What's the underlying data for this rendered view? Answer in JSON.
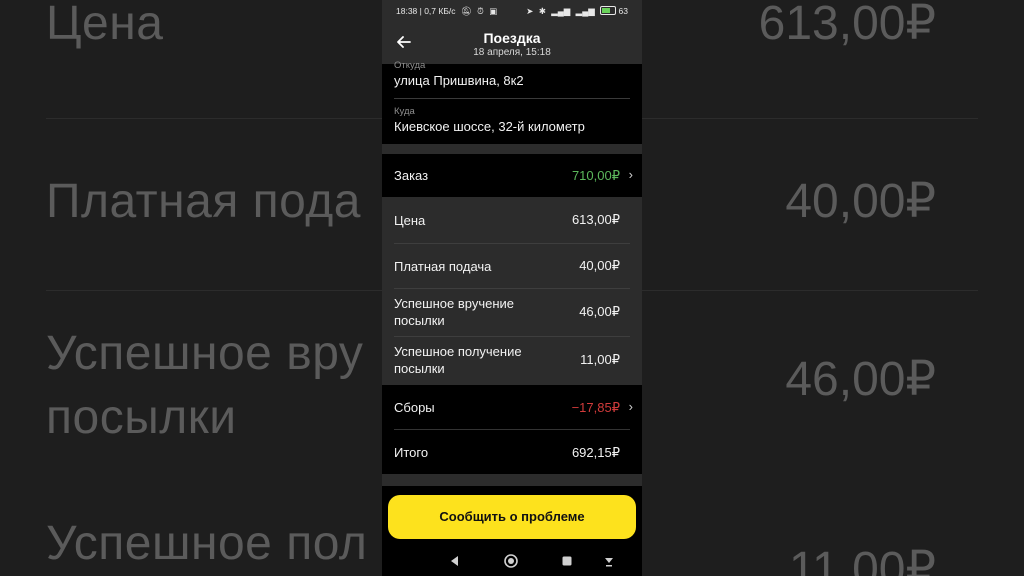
{
  "background": {
    "rows": [
      {
        "label": "Цена",
        "value": "613,00₽"
      },
      {
        "label": "Платная пода",
        "value": "40,00₽"
      },
      {
        "label": "Успешное вру",
        "label2": "посылки",
        "value": "46,00₽"
      },
      {
        "label": "Успешное пол",
        "value": "11,00₽"
      }
    ]
  },
  "statusbar": {
    "left": "18:38 | 0,7 КБ/с",
    "battery": "63"
  },
  "header": {
    "title": "Поездка",
    "subtitle": "18 апреля, 15:18"
  },
  "route": {
    "from_label": "Откуда",
    "from_value": "улица Пришвина, 8к2",
    "to_label": "Куда",
    "to_value": "Киевское шоссе, 32-й километр"
  },
  "order": {
    "label": "Заказ",
    "value": "710,00₽"
  },
  "breakdown": [
    {
      "label": "Цена",
      "value": "613,00₽"
    },
    {
      "label": "Платная подача",
      "value": "40,00₽"
    },
    {
      "label": "Успешное вручение посылки",
      "value": "46,00₽"
    },
    {
      "label": "Успешное получение посылки",
      "value": "11,00₽"
    }
  ],
  "fees": {
    "label": "Сборы",
    "value": "−17,85₽"
  },
  "total": {
    "label": "Итого",
    "value": "692,15₽"
  },
  "cta": {
    "label": "Сообщить о проблеме"
  },
  "colors": {
    "accent_yellow": "#fde21d",
    "positive_green": "#5cb85c",
    "negative_red": "#d13b3b"
  }
}
